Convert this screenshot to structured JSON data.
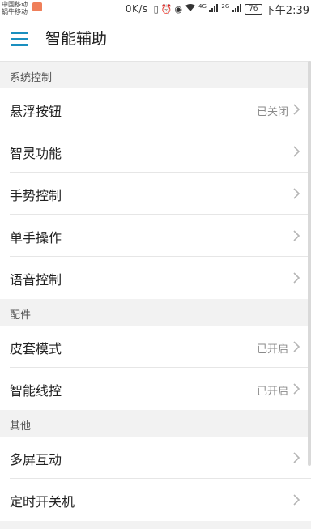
{
  "status_bar": {
    "carrier_line1": "中国移动",
    "carrier_line2": "蜗牛移动",
    "net_speed": "0K/s",
    "signal1": "4G",
    "signal2": "2G",
    "battery": "76",
    "time": "下午2:39"
  },
  "header": {
    "title": "智能辅助"
  },
  "sections": [
    {
      "title": "系统控制",
      "items": [
        {
          "label": "悬浮按钮",
          "value": "已关闭"
        },
        {
          "label": "智灵功能",
          "value": ""
        },
        {
          "label": "手势控制",
          "value": ""
        },
        {
          "label": "单手操作",
          "value": ""
        },
        {
          "label": "语音控制",
          "value": ""
        }
      ]
    },
    {
      "title": "配件",
      "items": [
        {
          "label": "皮套模式",
          "value": "已开启"
        },
        {
          "label": "智能线控",
          "value": "已开启"
        }
      ]
    },
    {
      "title": "其他",
      "items": [
        {
          "label": "多屏互动",
          "value": ""
        },
        {
          "label": "定时开关机",
          "value": ""
        }
      ]
    }
  ],
  "colors": {
    "accent": "#1a8fbf",
    "section_bg": "#f2f2f2",
    "value_text": "#8a8a8a"
  }
}
